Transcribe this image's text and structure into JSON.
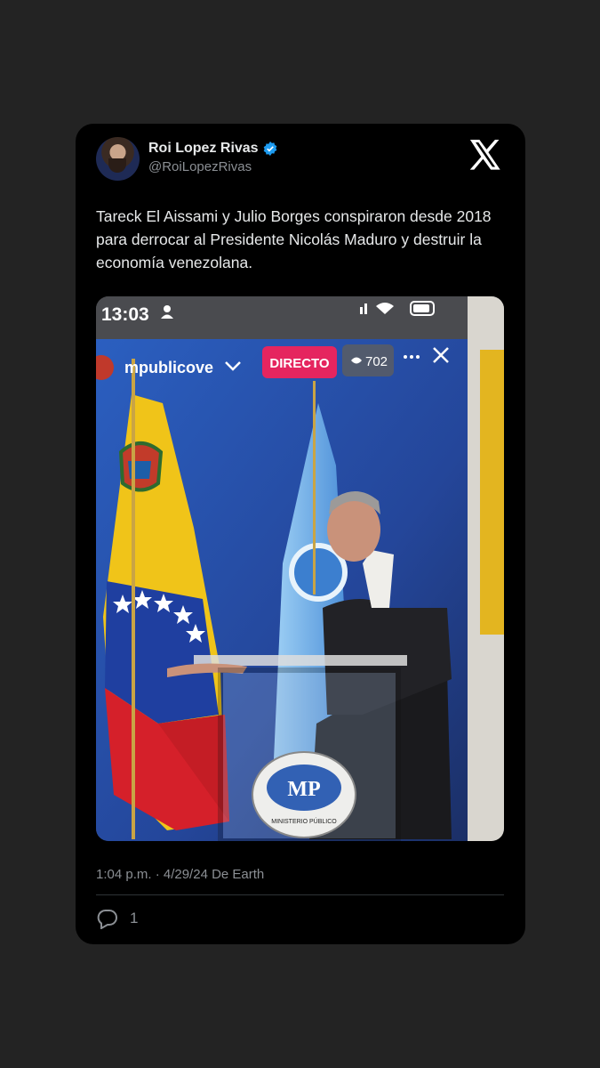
{
  "tweet": {
    "author_name": "Roi Lopez Rivas",
    "handle": "@RoiLopezRivas",
    "text": "Tareck El Aissami y Julio Borges conspiraron desde 2018 para derrocar al Presidente Nicolás Maduro y destruir la economía venezolana.",
    "timestamp": "1:04 p.m. · 4/29/24 De Earth",
    "reply_count": "1"
  },
  "media": {
    "phone_time": "13:03",
    "account": "mpublicove",
    "live_badge": "DIRECTO",
    "viewers": "702",
    "podium_label": "MINISTERIO PÚBLICO",
    "podium_logo": "MP"
  },
  "colors": {
    "background": "#232323",
    "card": "#000000",
    "verified": "#1d9bf0",
    "live_badge": "#e5255f"
  }
}
